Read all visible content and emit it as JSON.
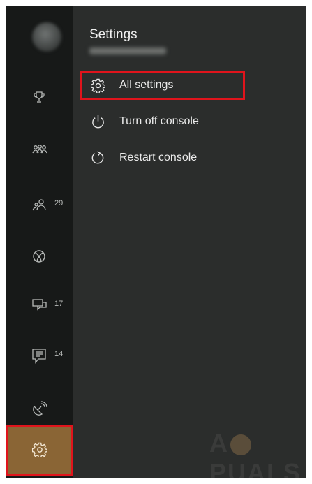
{
  "settings_panel": {
    "title": "Settings",
    "items": [
      {
        "label": "All settings",
        "icon": "gear-icon"
      },
      {
        "label": "Turn off console",
        "icon": "power-icon"
      },
      {
        "label": "Restart console",
        "icon": "restart-icon"
      }
    ]
  },
  "sidebar": {
    "items": [
      {
        "icon": "trophy-icon"
      },
      {
        "icon": "party-icon"
      },
      {
        "icon": "friends-icon",
        "badge": "29"
      },
      {
        "icon": "xbox-icon"
      },
      {
        "icon": "messages-icon",
        "badge": "17"
      },
      {
        "icon": "notifications-icon",
        "badge": "14"
      },
      {
        "icon": "broadcast-icon"
      },
      {
        "icon": "gear-icon",
        "selected": true
      }
    ]
  },
  "colors": {
    "selected_bg": "#8a6535",
    "highlight": "#e0141c",
    "panel_bg": "#2b2d2c",
    "rail_bg": "#171918"
  },
  "watermark": {
    "text_left": "A",
    "text_right": "PUALS"
  }
}
